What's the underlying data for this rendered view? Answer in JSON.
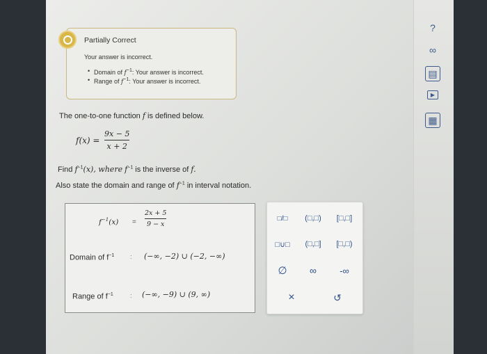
{
  "feedback": {
    "title": "Partially Correct",
    "message": "Your answer is incorrect.",
    "bullets": [
      {
        "prefix": "Domain of",
        "symbol": "f",
        "sup": "−1",
        "suffix": ": Your answer is incorrect."
      },
      {
        "prefix": "Range of",
        "symbol": "f",
        "sup": "−1",
        "suffix": ": Your answer is incorrect."
      }
    ],
    "color": "#d9b648"
  },
  "problem": {
    "intro_a": "The one-to-one function",
    "intro_var": "f",
    "intro_b": "is defined below.",
    "fx_lhs": "f(x) =",
    "fx_num": "9x − 5",
    "fx_den": "x + 2",
    "find_a": "Find",
    "find_b": "f",
    "find_sup": "−1",
    "find_c": "(x), where",
    "find_d": "f",
    "find_sup2": "−1",
    "find_e": "is the inverse of",
    "find_f": "f.",
    "also_a": "Also state the domain and range of",
    "also_var": "f",
    "also_sup": "−1",
    "also_b": "in interval notation."
  },
  "answer": {
    "lhs_f": "f",
    "lhs_sup": "−1",
    "lhs_arg": "(x)",
    "eq": "=",
    "num": "2x + 5",
    "den": "9 − x",
    "domain_label": "Domain of f",
    "domain_sup": "−1",
    "colon": ":",
    "domain_value": "(−∞, −2) ∪ (−2, −∞)",
    "range_label": "Range of f",
    "range_sup": "−1",
    "range_value": "(−∞, −9) ∪ (9, ∞)"
  },
  "keypad": {
    "fraction": "□/□",
    "open_open": "(□,□)",
    "closed_closed": "[□,□]",
    "union": "□∪□",
    "open_closed": "(□,□]",
    "closed_open": "[□,□)",
    "empty_set": "∅",
    "infinity": "∞",
    "neg_infinity": "-∞",
    "clear": "×",
    "undo": "↺"
  },
  "sidebar": {
    "help": "?",
    "link": "∞",
    "reader": "▤",
    "video": "▶",
    "calc": "▦"
  }
}
